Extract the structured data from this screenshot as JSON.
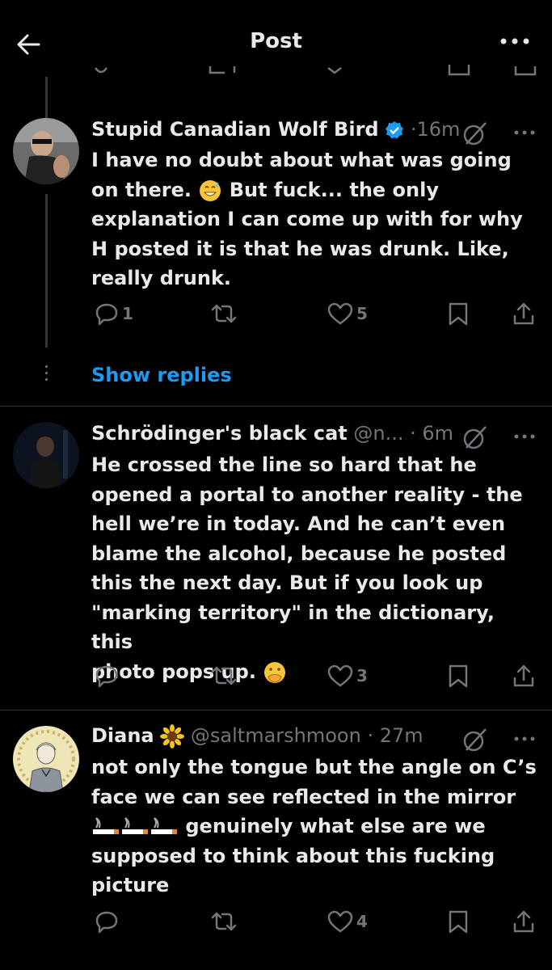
{
  "header": {
    "title": "Post"
  },
  "tweets": [
    {
      "name": "Stupid Canadian Wolf Bird",
      "meta": "·16m",
      "text": "I have no doubt about what was going\non there. ",
      "text_b": " But fuck... the only\nexplanation I can come up with for why\nH posted it is that he was drunk. Like,\nreally drunk.",
      "reply_count": "1",
      "retweet_count": "",
      "like_count": "5"
    },
    {
      "name": "Schrödinger's black cat",
      "meta": "@n... · 6m",
      "text": "He crossed the line so hard that he\nopened a portal to another reality - the\nhell we’re in today. And he can’t even\nblame the alcohol, because he posted\nthis the next day. But if you look up\n\"marking territory\" in the dictionary, this\nphoto pops up. ",
      "reply_count": "",
      "retweet_count": "",
      "like_count": "3"
    },
    {
      "name": "Diana",
      "meta": "@saltmarshmoon · 27m",
      "text": "not only the tongue but the angle on C’s\nface we can see reflected in the mirror",
      "text_b": " genuinely what else are we\nsupposed to think about this fucking\npicture",
      "reply_count": "",
      "retweet_count": "",
      "like_count": "4"
    }
  ],
  "show_replies": "Show replies",
  "colors": {
    "accent": "#1d9bf0",
    "muted": "#71767b",
    "text": "#e7e9ea",
    "background": "#000000",
    "verified": "#1d9bf0"
  },
  "icons": [
    "back-arrow-icon",
    "more-icon",
    "reply-icon",
    "retweet-icon",
    "like-icon",
    "bookmark-icon",
    "share-icon",
    "grok-icon",
    "verified-badge-icon"
  ]
}
